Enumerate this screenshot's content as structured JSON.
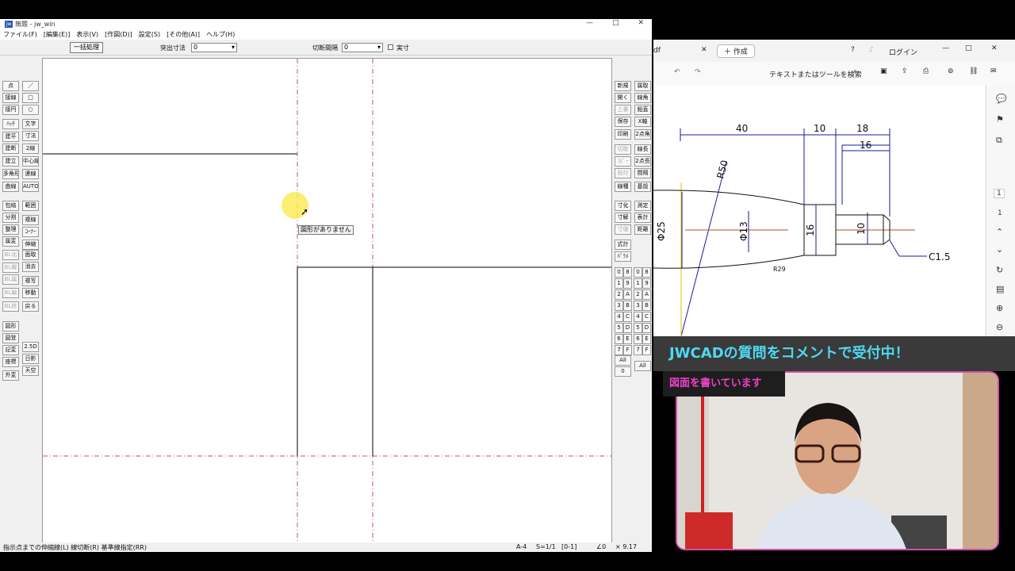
{
  "jw": {
    "title": "無題 - jw_win",
    "menu": [
      "ファイル(F)",
      "[編集(E)]",
      "表示(V)",
      "[作図(D)]",
      "設定(S)",
      "[その他(A)]",
      "ヘルプ(H)"
    ],
    "toolbar": {
      "batch_button": "一括処理",
      "extend_label": "突出寸法",
      "extend_value": "0",
      "cut_label": "切断間隔",
      "cut_value": "0",
      "actual_label": "実寸"
    },
    "left_tools_col1": [
      "点",
      "接線",
      "接円",
      "ﾊｯﾁ",
      "建平",
      "建断",
      "建立",
      "多角形",
      "曲線",
      "包絡",
      "分割",
      "整理",
      "属変",
      "BL化",
      "BL解",
      "BL属",
      "BL編",
      "BL終",
      "図形",
      "図登",
      "記変",
      "座標",
      "外変"
    ],
    "left_tools_col2": [
      "／",
      "□",
      "○",
      "文字",
      "寸法",
      "2線",
      "中心線",
      "連線",
      "AUTO",
      "範囲",
      "複線",
      "ｺｰﾅｰ",
      "伸縮",
      "面取",
      "消去",
      "複写",
      "移動",
      "戻る",
      "",
      "2.5D",
      "日影",
      "天空"
    ],
    "right_tools_col1": [
      "新規",
      "開く",
      "上書",
      "保存",
      "印刷",
      "切取",
      "ｺﾋﾟｰ",
      "貼付",
      "線種",
      "寸化",
      "寸解",
      "寸値",
      "",
      "式計",
      "ﾊﾟﾗﾒ"
    ],
    "right_tools_col2": [
      "属取",
      "線角",
      "鉛直",
      "X軸",
      "2点角",
      "線長",
      "2点長",
      "間隔",
      "基設",
      "測定",
      "表計",
      "距離"
    ],
    "layer_groups": {
      "left": [
        "0",
        "1",
        "2",
        "3",
        "4",
        "5",
        "6",
        "7",
        "8",
        "9",
        "A",
        "B",
        "C",
        "D",
        "E",
        "F"
      ],
      "right": [
        "0",
        "8",
        "1",
        "9",
        "2",
        "A",
        "3",
        "B",
        "4",
        "C",
        "5",
        "D",
        "6",
        "E",
        "7",
        "F"
      ],
      "all_left": "All",
      "zero": "0",
      "all_right": "All"
    },
    "tooltip": "図形がありません",
    "status": {
      "message": "指示点までの伸縮線(L) 線切断(R) 基準線指定(RR)",
      "paper": "A-4",
      "scale": "S=1/1",
      "layer": "[0-1]",
      "angle": "∠0",
      "zoom": "× 9.17"
    }
  },
  "pdf": {
    "tab_title": "df",
    "new_tab": "作成",
    "login": "ログイン",
    "search": "テキストまたはツールを検索",
    "page_current": "1",
    "page_total": "1",
    "drawing": {
      "dim_40": "40",
      "dim_10": "10",
      "dim_18": "18",
      "dim_16_top": "16",
      "r50": "R50",
      "phi25": "Φ25",
      "phi13": "Φ13",
      "dim_16_side": "16",
      "dim_10_side": "10",
      "r29": "R29",
      "c15": "C1.5"
    }
  },
  "overlay": {
    "banner": "JWCADの質問をコメントで受付中！",
    "sub": "図面を書いています"
  }
}
